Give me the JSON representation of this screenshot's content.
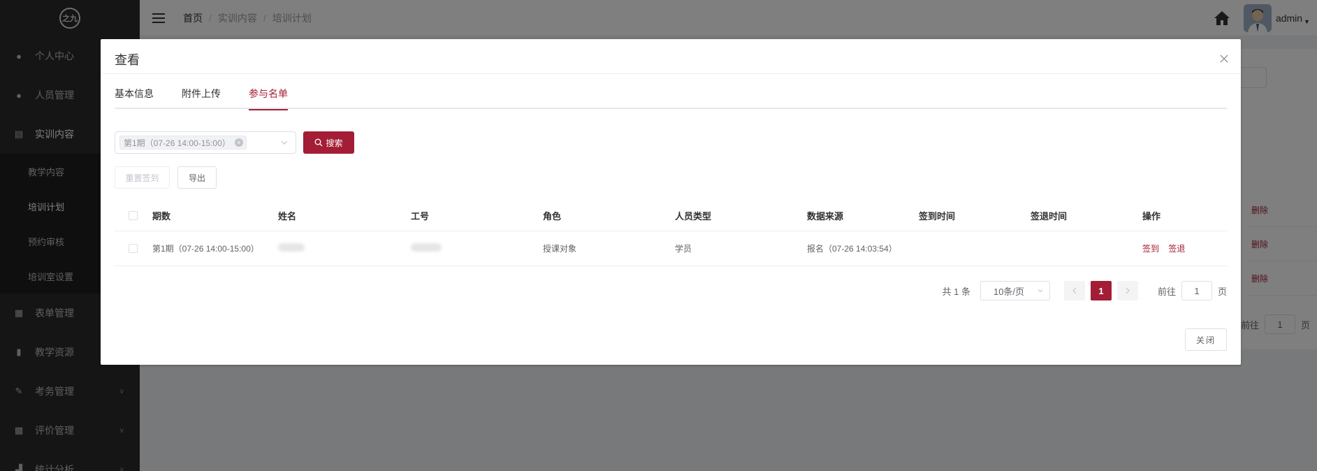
{
  "sidebar": {
    "logo_text": "之九",
    "items": [
      {
        "label": "个人中心",
        "icon": "user-icon"
      },
      {
        "label": "人员管理",
        "icon": "users-icon"
      },
      {
        "label": "实训内容",
        "icon": "book-icon"
      },
      {
        "label": "表单管理",
        "icon": "form-icon"
      },
      {
        "label": "教学资源",
        "icon": "resource-icon"
      },
      {
        "label": "考务管理",
        "icon": "exam-icon"
      },
      {
        "label": "评价管理",
        "icon": "evaluation-icon"
      },
      {
        "label": "统计分析",
        "icon": "chart-icon"
      }
    ],
    "sub_items": [
      "教学内容",
      "培训计划",
      "预约审核",
      "培训室设置"
    ]
  },
  "header": {
    "breadcrumb": [
      "首页",
      "实训内容",
      "培训计划"
    ],
    "username": "admin"
  },
  "background": {
    "delete_label": "删除",
    "goto_label": "前往",
    "goto_value": "1",
    "page_label": "页"
  },
  "dialog": {
    "title": "查看",
    "tabs": [
      "基本信息",
      "附件上传",
      "参与名单"
    ],
    "active_tab": 2,
    "filter_tag": "第1期（07-26 14:00-15:00）",
    "search_label": "搜索",
    "reset_signin_label": "重置签到",
    "export_label": "导出",
    "columns": [
      "期数",
      "姓名",
      "工号",
      "角色",
      "人员类型",
      "数据来源",
      "签到时间",
      "签退时间",
      "操作"
    ],
    "rows": [
      {
        "period": "第1期（07-26 14:00-15:00）",
        "name": "",
        "job_no": "",
        "role": "授课对象",
        "person_type": "学员",
        "source": "报名（07-26 14:03:54）",
        "signin_time": "",
        "signout_time": "",
        "actions": [
          "签到",
          "签退"
        ]
      }
    ],
    "pagination": {
      "total_text": "共 1 条",
      "page_size": "10条/页",
      "current_page": "1",
      "goto_label": "前往",
      "goto_value": "1",
      "page_suffix": "页"
    },
    "close_label": "关闭"
  },
  "colors": {
    "primary": "#a31d36",
    "sidebar_bg": "#2b2b2b"
  }
}
